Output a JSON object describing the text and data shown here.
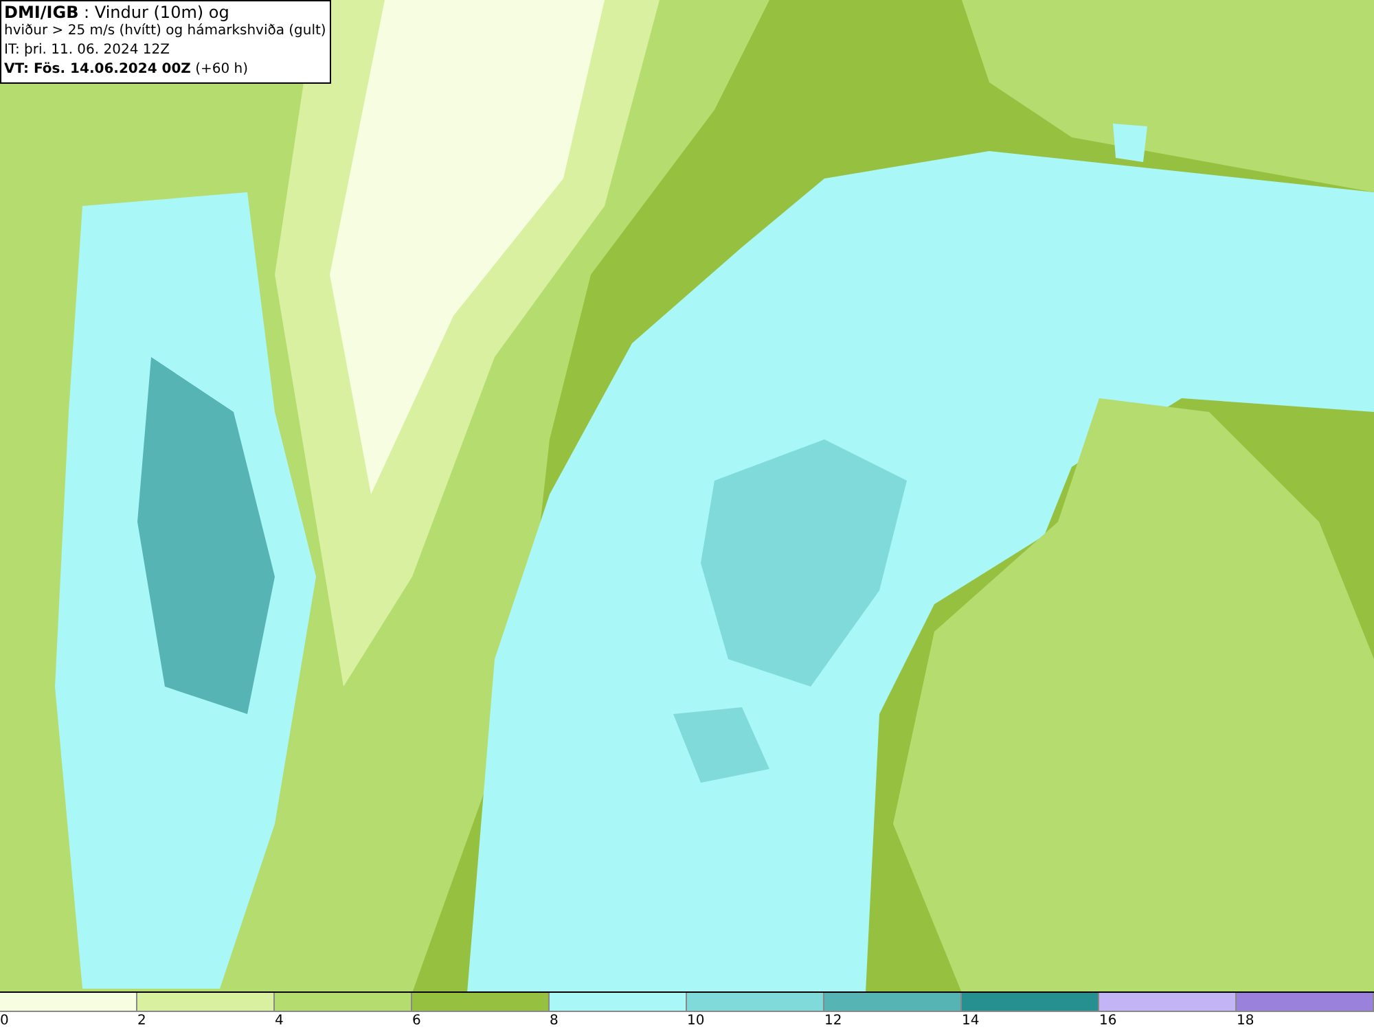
{
  "info_box": {
    "lines": [
      "**DMI/IGB** : Vindur (10m) og",
      "hviður > 25 m/s (hvítt) og hámarkshviða (gult)",
      "IT: þri. 11. 06. 2024 12Z",
      "**VT: Fös. 14.06.2024 00Z** (+60 h)"
    ]
  },
  "legend": [
    {
      "label": "0",
      "color": "#f7fde0"
    },
    {
      "label": "2",
      "color": "#d8f0a0"
    },
    {
      "label": "4",
      "color": "#b5dc6e"
    },
    {
      "label": "6",
      "color": "#96c040"
    },
    {
      "label": "8",
      "color": "#aaf7f7"
    },
    {
      "label": "10",
      "color": "#80dada"
    },
    {
      "label": "12",
      "color": "#56b4b4"
    },
    {
      "label": "14",
      "color": "#269090"
    },
    {
      "label": "16",
      "color": "#c3b4f5"
    },
    {
      "label": "18",
      "color": "#9a82dc"
    }
  ]
}
